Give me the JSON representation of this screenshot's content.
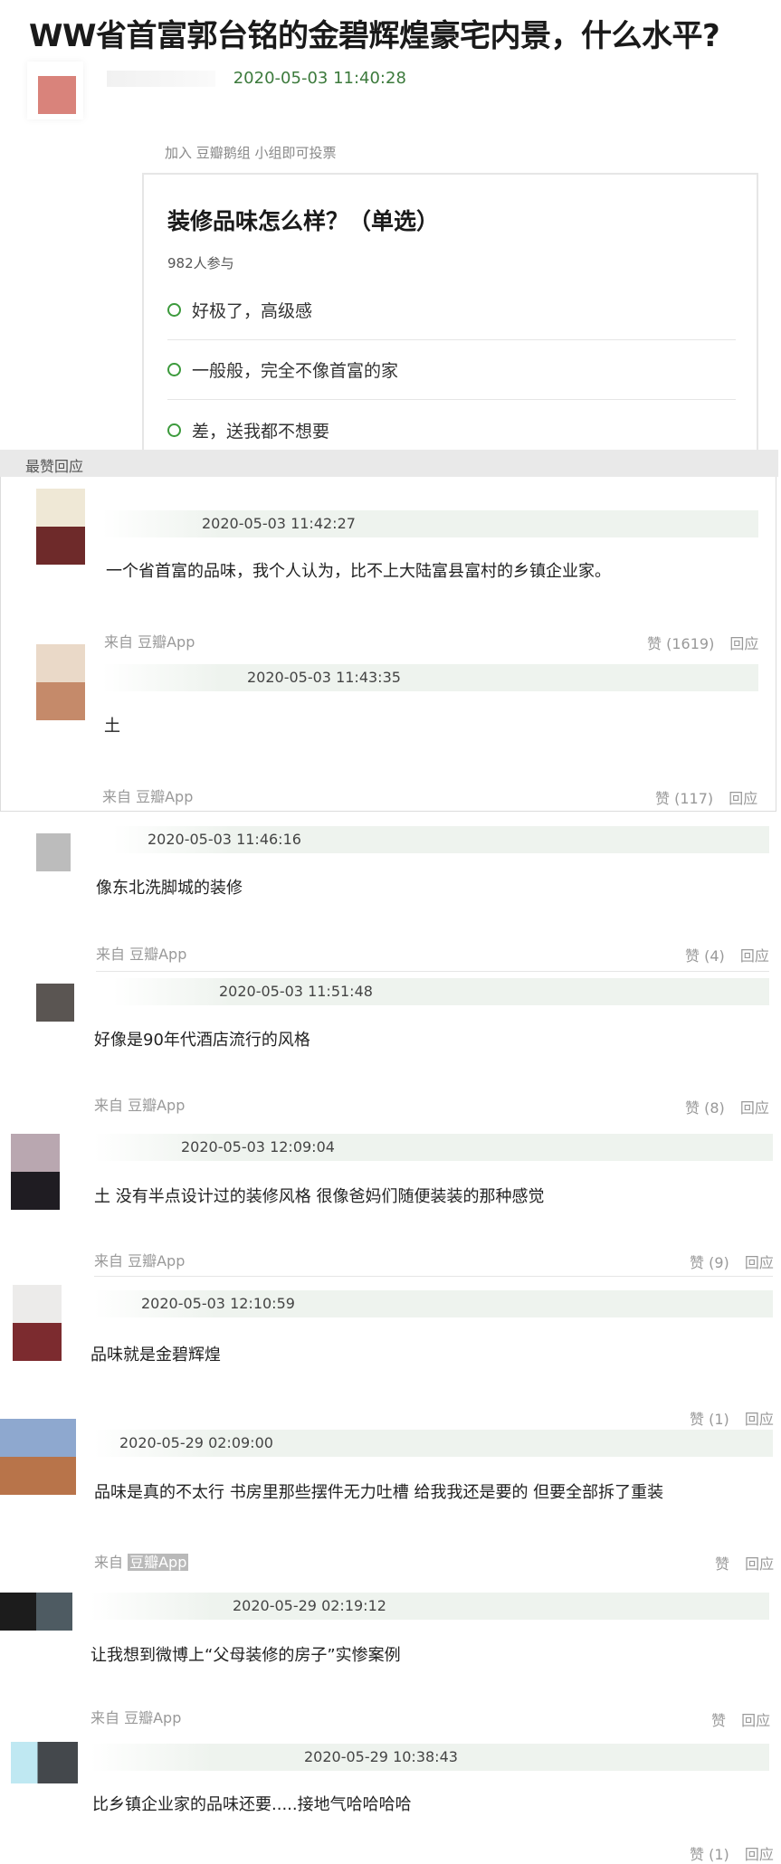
{
  "post": {
    "title": "WW省首富郭台铭的金碧辉煌豪宅内景，什么水平?",
    "date": "2020-05-03 11:40:28"
  },
  "vote": {
    "join_tip": "加入 豆瓣鹅组 小组即可投票",
    "title": "装修品味怎么样？（单选）",
    "participants": "982人参与",
    "options": [
      "好极了，高级感",
      "一般般，完全不像首富的家",
      "差，送我都不想要"
    ]
  },
  "section": {
    "label": "最赞回应"
  },
  "labels": {
    "like": "赞",
    "reply": "回应"
  },
  "comments": [
    {
      "date": "2020-05-03 11:42:27",
      "text": "一个省首富的品味，我个人认为，比不上大陆富县富村的乡镇企业家。",
      "from": "来自 豆瓣App",
      "likes": "(1619)"
    },
    {
      "date": "2020-05-03 11:43:35",
      "text": "土",
      "from": "来自 豆瓣App",
      "likes": "(117)"
    },
    {
      "date": "2020-05-03 11:46:16",
      "text": "像东北洗脚城的装修",
      "from": "来自 豆瓣App",
      "likes": "(4)"
    },
    {
      "date": "2020-05-03 11:51:48",
      "text": "好像是90年代酒店流行的风格",
      "from": "来自 豆瓣App",
      "likes": "(8)"
    },
    {
      "date": "2020-05-03 12:09:04",
      "text": "土 没有半点设计过的装修风格 很像爸妈们随便装装的那种感觉",
      "from": "来自 豆瓣App",
      "likes": "(9)"
    },
    {
      "date": "2020-05-03 12:10:59",
      "text": "品味就是金碧辉煌",
      "from": "来自 豆瓣App",
      "likes": "(1)"
    },
    {
      "date": "2020-05-29 02:09:00",
      "text": "品味是真的不太行 书房里那些摆件无力吐槽 给我我还是要的 但要全部拆了重装",
      "from_prefix": "来自 ",
      "from_highlight": "豆瓣App",
      "likes": ""
    },
    {
      "date": "2020-05-29 02:19:12",
      "text": "让我想到微博上“父母装修的房子”实惨案例",
      "from": "来自 豆瓣App",
      "likes": ""
    },
    {
      "date": "2020-05-29 10:38:43",
      "text": "比乡镇企业家的品味还要.....接地气哈哈哈哈",
      "likes": "(1)"
    }
  ],
  "colors": {
    "date_green": "#3c7a3c",
    "radio_green": "#3c9a3c",
    "muted": "#999999"
  }
}
